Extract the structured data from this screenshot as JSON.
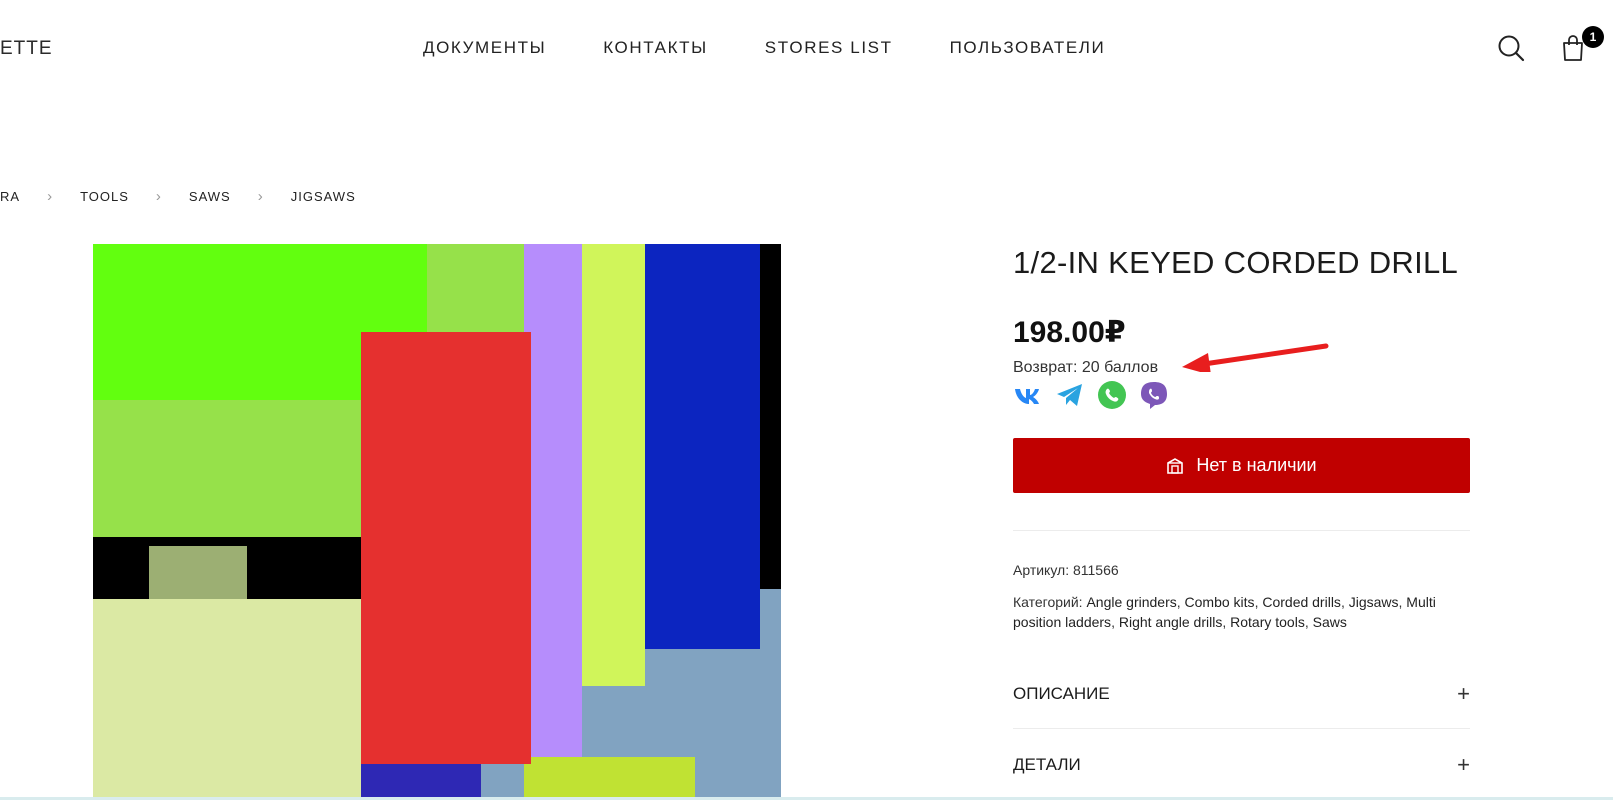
{
  "header": {
    "logo": "ETTE",
    "nav": [
      "Документы",
      "Контакты",
      "Stores list",
      "Пользователи"
    ],
    "cart_count": "1",
    "icons": [
      "search-icon",
      "cart-icon"
    ]
  },
  "breadcrumb": [
    "ra",
    "Tools",
    "Saws",
    "Jigsaws"
  ],
  "product": {
    "title": "1/2-in keyed corded drill",
    "price": "198.00₽",
    "cashback": "Возврат: 20 баллов",
    "share": [
      "vk-icon",
      "telegram-icon",
      "whatsapp-icon",
      "viber-icon"
    ],
    "stock_button": "Нет в наличии",
    "sku_label": "Артикул:",
    "sku": "811566",
    "categories_label": "Категорий:",
    "categories": [
      "Angle grinders",
      "Combo kits",
      "Corded drills",
      "Jigsaws",
      "Multi position ladders",
      "Right angle drills",
      "Rotary tools",
      "Saws"
    ],
    "accordions": [
      "Описание",
      "Детали"
    ]
  },
  "colors": {
    "accent": "#c00000",
    "annotation_arrow": "#e81e1e",
    "image_palette": [
      "#62ff0f",
      "#96e14a",
      "#b68dfc",
      "#d0f55a",
      "#0c25c0",
      "#000000",
      "#e5302f",
      "#dbe9a4",
      "#9caf73",
      "#81a3c1",
      "#2e28b4",
      "#c0e233"
    ]
  }
}
